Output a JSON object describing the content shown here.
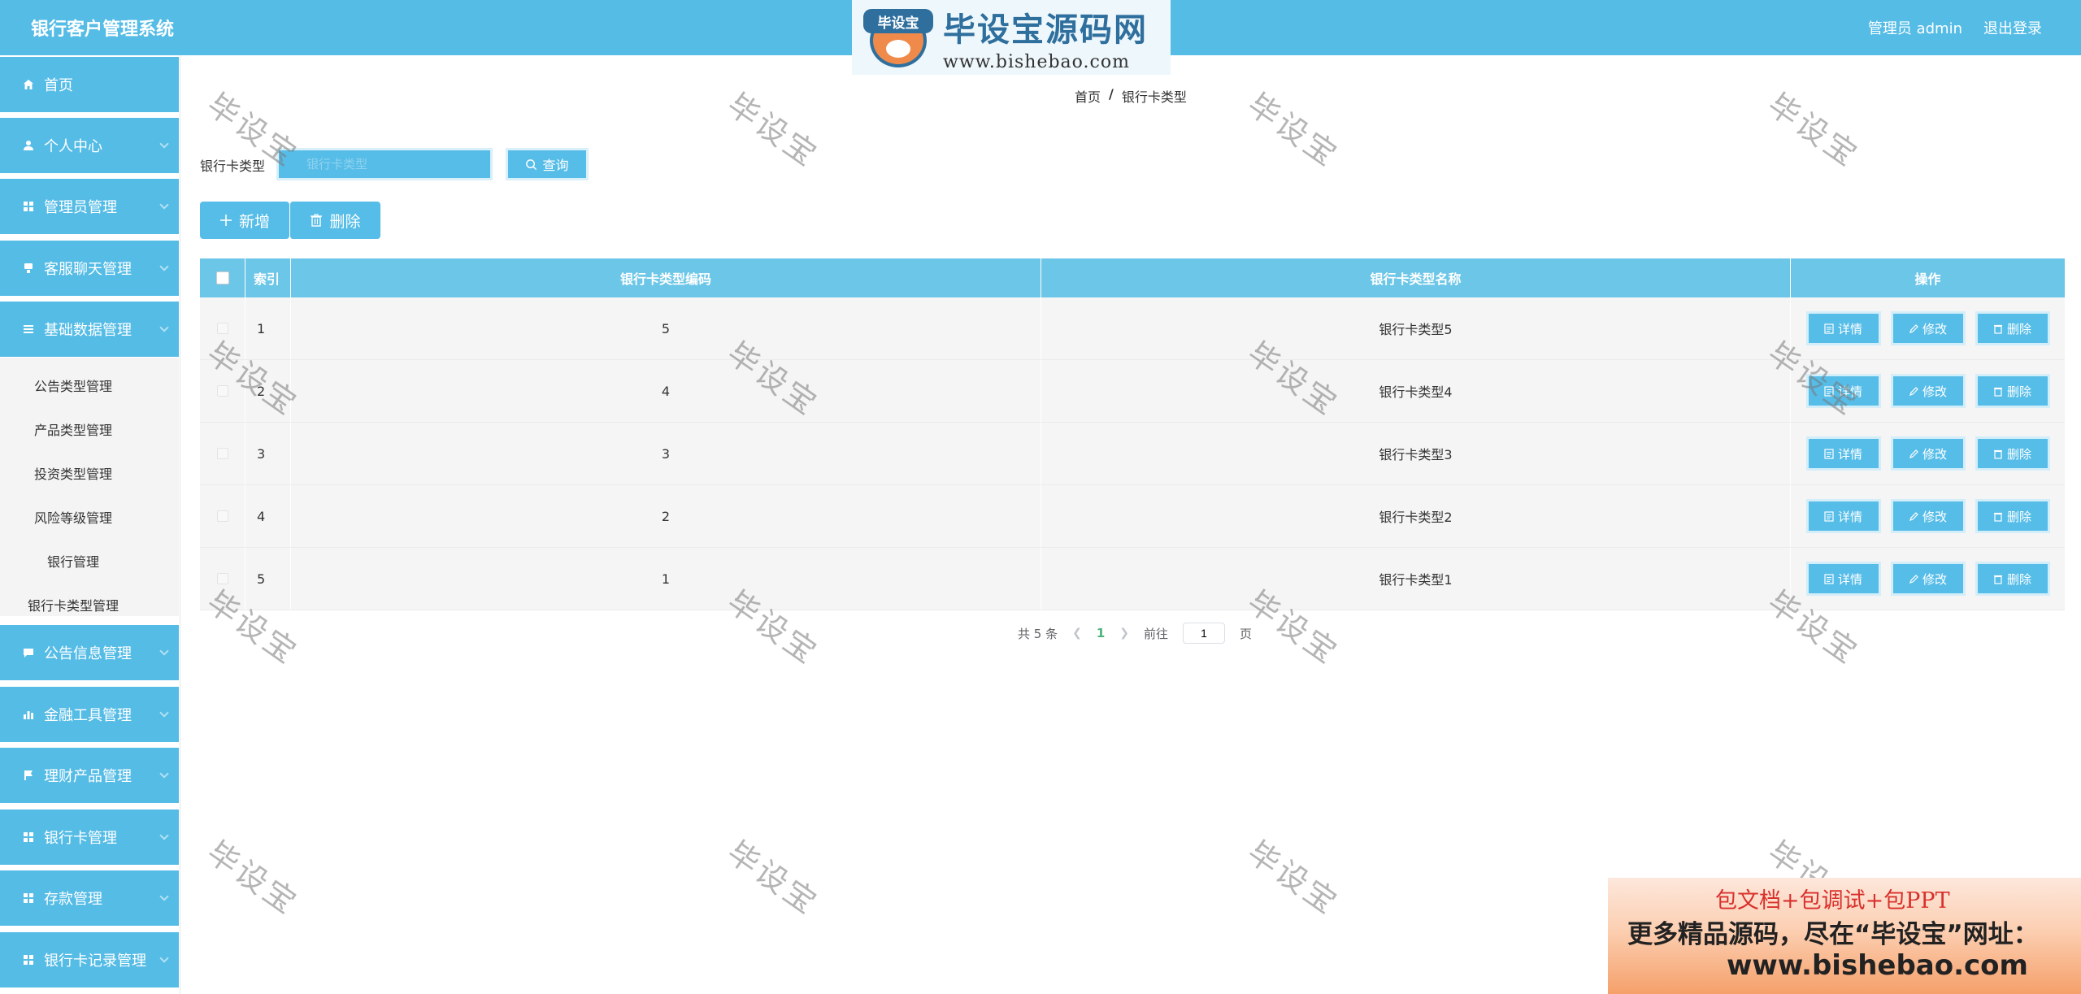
{
  "header": {
    "title": "银行客户管理系统",
    "admin_label": "管理员 admin",
    "logout_label": "退出登录"
  },
  "logo": {
    "badge_text": "毕设宝",
    "site_name": "毕设宝源码网",
    "url": "www.bishebao.com"
  },
  "sidebar": {
    "items": [
      {
        "label": "首页",
        "icon": "home-icon"
      },
      {
        "label": "个人中心",
        "icon": "user-icon"
      },
      {
        "label": "管理员管理",
        "icon": "grid-icon"
      },
      {
        "label": "客服聊天管理",
        "icon": "chat-icon"
      },
      {
        "label": "基础数据管理",
        "icon": "menu-icon"
      },
      {
        "label": "公告信息管理",
        "icon": "message-icon"
      },
      {
        "label": "金融工具管理",
        "icon": "bar-chart-icon"
      },
      {
        "label": "理财产品管理",
        "icon": "flag-icon"
      },
      {
        "label": "银行卡管理",
        "icon": "grid-icon"
      },
      {
        "label": "存款管理",
        "icon": "grid-icon"
      },
      {
        "label": "银行卡记录管理",
        "icon": "grid-icon"
      }
    ],
    "submenu": [
      {
        "label": "公告类型管理"
      },
      {
        "label": "产品类型管理"
      },
      {
        "label": "投资类型管理"
      },
      {
        "label": "风险等级管理"
      },
      {
        "label": "银行管理"
      },
      {
        "label": "银行卡类型管理"
      }
    ]
  },
  "breadcrumb": {
    "home": "首页",
    "separator": "/",
    "current": "银行卡类型"
  },
  "search": {
    "label": "银行卡类型",
    "placeholder": "银行卡类型",
    "button_label": "查询"
  },
  "actions": {
    "add_label": "新增",
    "delete_label": "删除"
  },
  "table": {
    "columns": [
      "索引",
      "银行卡类型编码",
      "银行卡类型名称",
      "操作"
    ],
    "rows": [
      {
        "index": "1",
        "code": "5",
        "name": "银行卡类型5"
      },
      {
        "index": "2",
        "code": "4",
        "name": "银行卡类型4"
      },
      {
        "index": "3",
        "code": "3",
        "name": "银行卡类型3"
      },
      {
        "index": "4",
        "code": "2",
        "name": "银行卡类型2"
      },
      {
        "index": "5",
        "code": "1",
        "name": "银行卡类型1"
      }
    ],
    "row_actions": {
      "detail": "详情",
      "edit": "修改",
      "delete": "删除"
    }
  },
  "pagination": {
    "total": "共 5 条",
    "current_page": "1",
    "goto_label": "前往",
    "goto_value": "1",
    "page_suffix": "页"
  },
  "watermark": "毕设宝",
  "ad": {
    "line1": "包文档+包调试+包PPT",
    "line2": "更多精品源码，尽在“毕设宝”网址：",
    "line3": "www.bishebao.com"
  },
  "colors": {
    "primary": "#55bce6",
    "table_header": "#6cc6e7",
    "row_bg": "#f5f5f5"
  }
}
